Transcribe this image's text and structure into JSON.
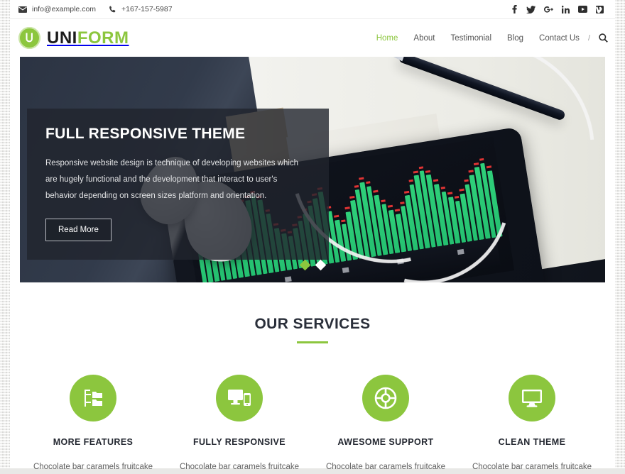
{
  "topbar": {
    "email": "info@example.com",
    "phone": "+167-157-5987",
    "email_icon": "envelope-icon",
    "phone_icon": "phone-icon",
    "socials": [
      {
        "name": "facebook",
        "glyph": "f"
      },
      {
        "name": "twitter",
        "glyph": "t"
      },
      {
        "name": "google-plus",
        "glyph": "g"
      },
      {
        "name": "linkedin",
        "glyph": "in"
      },
      {
        "name": "youtube",
        "glyph": "yt"
      },
      {
        "name": "vimeo",
        "glyph": "v"
      }
    ]
  },
  "header": {
    "brand_first": "UNI",
    "brand_second": "FORM",
    "nav": [
      {
        "label": "Home",
        "active": true
      },
      {
        "label": "About",
        "active": false
      },
      {
        "label": "Testimonial",
        "active": false
      },
      {
        "label": "Blog",
        "active": false
      },
      {
        "label": "Contact Us",
        "active": false
      }
    ],
    "nav_separator": "/",
    "search_icon": "search-icon"
  },
  "hero": {
    "title": "FULL RESPONSIVE THEME",
    "text": "Responsive website design is technique of developing websites which are hugely functional and the development that interact to user's behavior depending on screen sizes platform and orientation.",
    "button": "Read More",
    "slides": [
      {
        "index": 1,
        "active": true
      },
      {
        "index": 2,
        "active": false
      }
    ]
  },
  "services": {
    "heading": "OUR SERVICES",
    "items": [
      {
        "icon": "sitemap-icon",
        "title": "MORE FEATURES",
        "text": "Chocolate bar caramels fruitcake"
      },
      {
        "icon": "devices-icon",
        "title": "FULLY RESPONSIVE",
        "text": "Chocolate bar caramels fruitcake"
      },
      {
        "icon": "life-ring-icon",
        "title": "AWESOME SUPPORT",
        "text": "Chocolate bar caramels fruitcake"
      },
      {
        "icon": "desktop-icon",
        "title": "CLEAN THEME",
        "text": "Chocolate bar caramels fruitcake"
      }
    ]
  },
  "colors": {
    "accent_green": "#8cc63e",
    "heading_dark": "#2a2f3a",
    "hero_overlay": "rgba(32,36,45,.80)"
  }
}
